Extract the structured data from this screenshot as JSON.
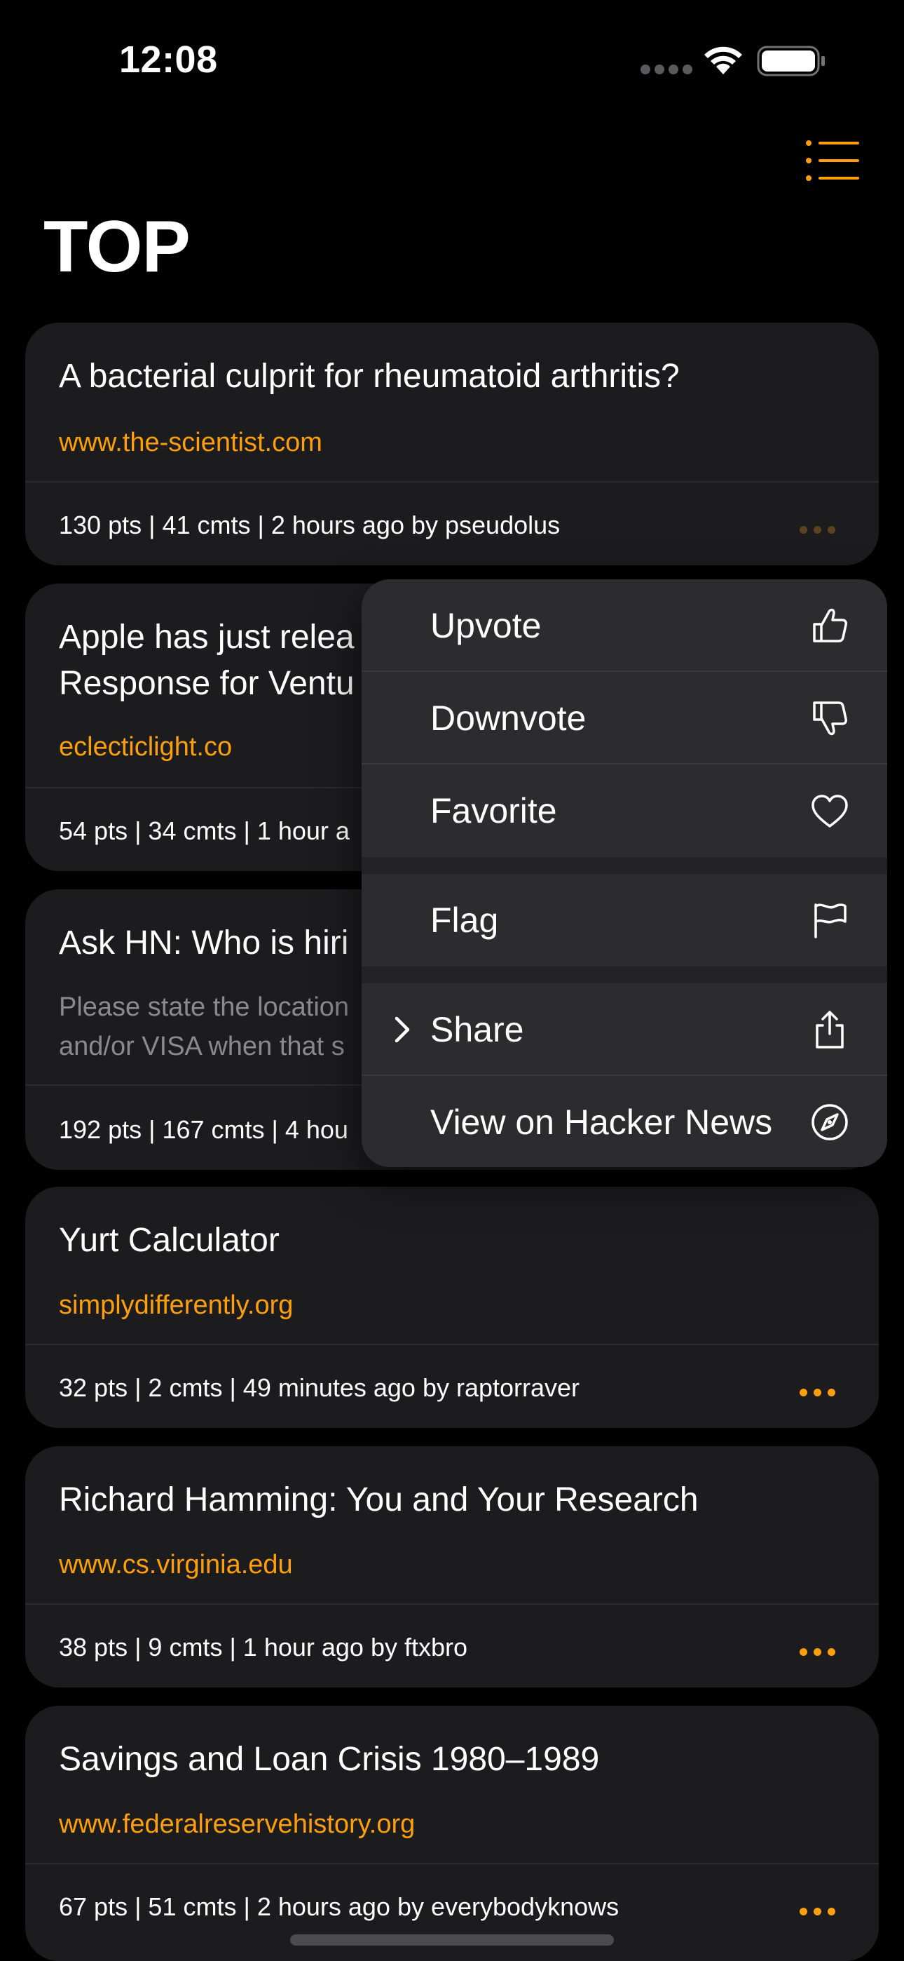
{
  "status_bar": {
    "time": "12:08"
  },
  "header": {
    "title": "TOP"
  },
  "colors": {
    "accent": "#ff9f0a",
    "card_bg": "#1c1c1e",
    "menu_bg": "#2c2c2e",
    "background": "#000000"
  },
  "stories": [
    {
      "title": "A bacterial culprit for rheumatoid arthritis?",
      "domain": "www.the-scientist.com",
      "meta": "130 pts | 41 cmts | 2 hours ago by pseudolus"
    },
    {
      "title_line1": "Apple has just relea",
      "title_line2": "Response for Ventu",
      "domain": "eclecticlight.co",
      "meta": "54 pts | 34 cmts | 1 hour a"
    },
    {
      "title": "Ask HN: Who is hiri",
      "snippet_line1": "Please state the location",
      "snippet_line2": "and/or VISA when that s",
      "meta": "192 pts | 167 cmts | 4 hou"
    },
    {
      "title": "Yurt Calculator",
      "domain": "simplydifferently.org",
      "meta": "32 pts | 2 cmts | 49 minutes ago by raptorraver"
    },
    {
      "title": "Richard Hamming: You and Your Research",
      "domain": "www.cs.virginia.edu",
      "meta": "38 pts | 9 cmts | 1 hour ago by ftxbro"
    },
    {
      "title": "Savings and Loan Crisis 1980–1989",
      "domain": "www.federalreservehistory.org",
      "meta": "67 pts | 51 cmts | 2 hours ago by everybodyknows"
    }
  ],
  "context_menu": {
    "upvote": "Upvote",
    "downvote": "Downvote",
    "favorite": "Favorite",
    "flag": "Flag",
    "share": "Share",
    "view_on_hn": "View on Hacker News"
  },
  "icons": [
    "list-icon",
    "thumbs-up-icon",
    "thumbs-down-icon",
    "heart-icon",
    "flag-icon",
    "share-icon",
    "compass-icon",
    "chevron-right-icon",
    "more-icon",
    "wifi-icon",
    "battery-icon"
  ]
}
